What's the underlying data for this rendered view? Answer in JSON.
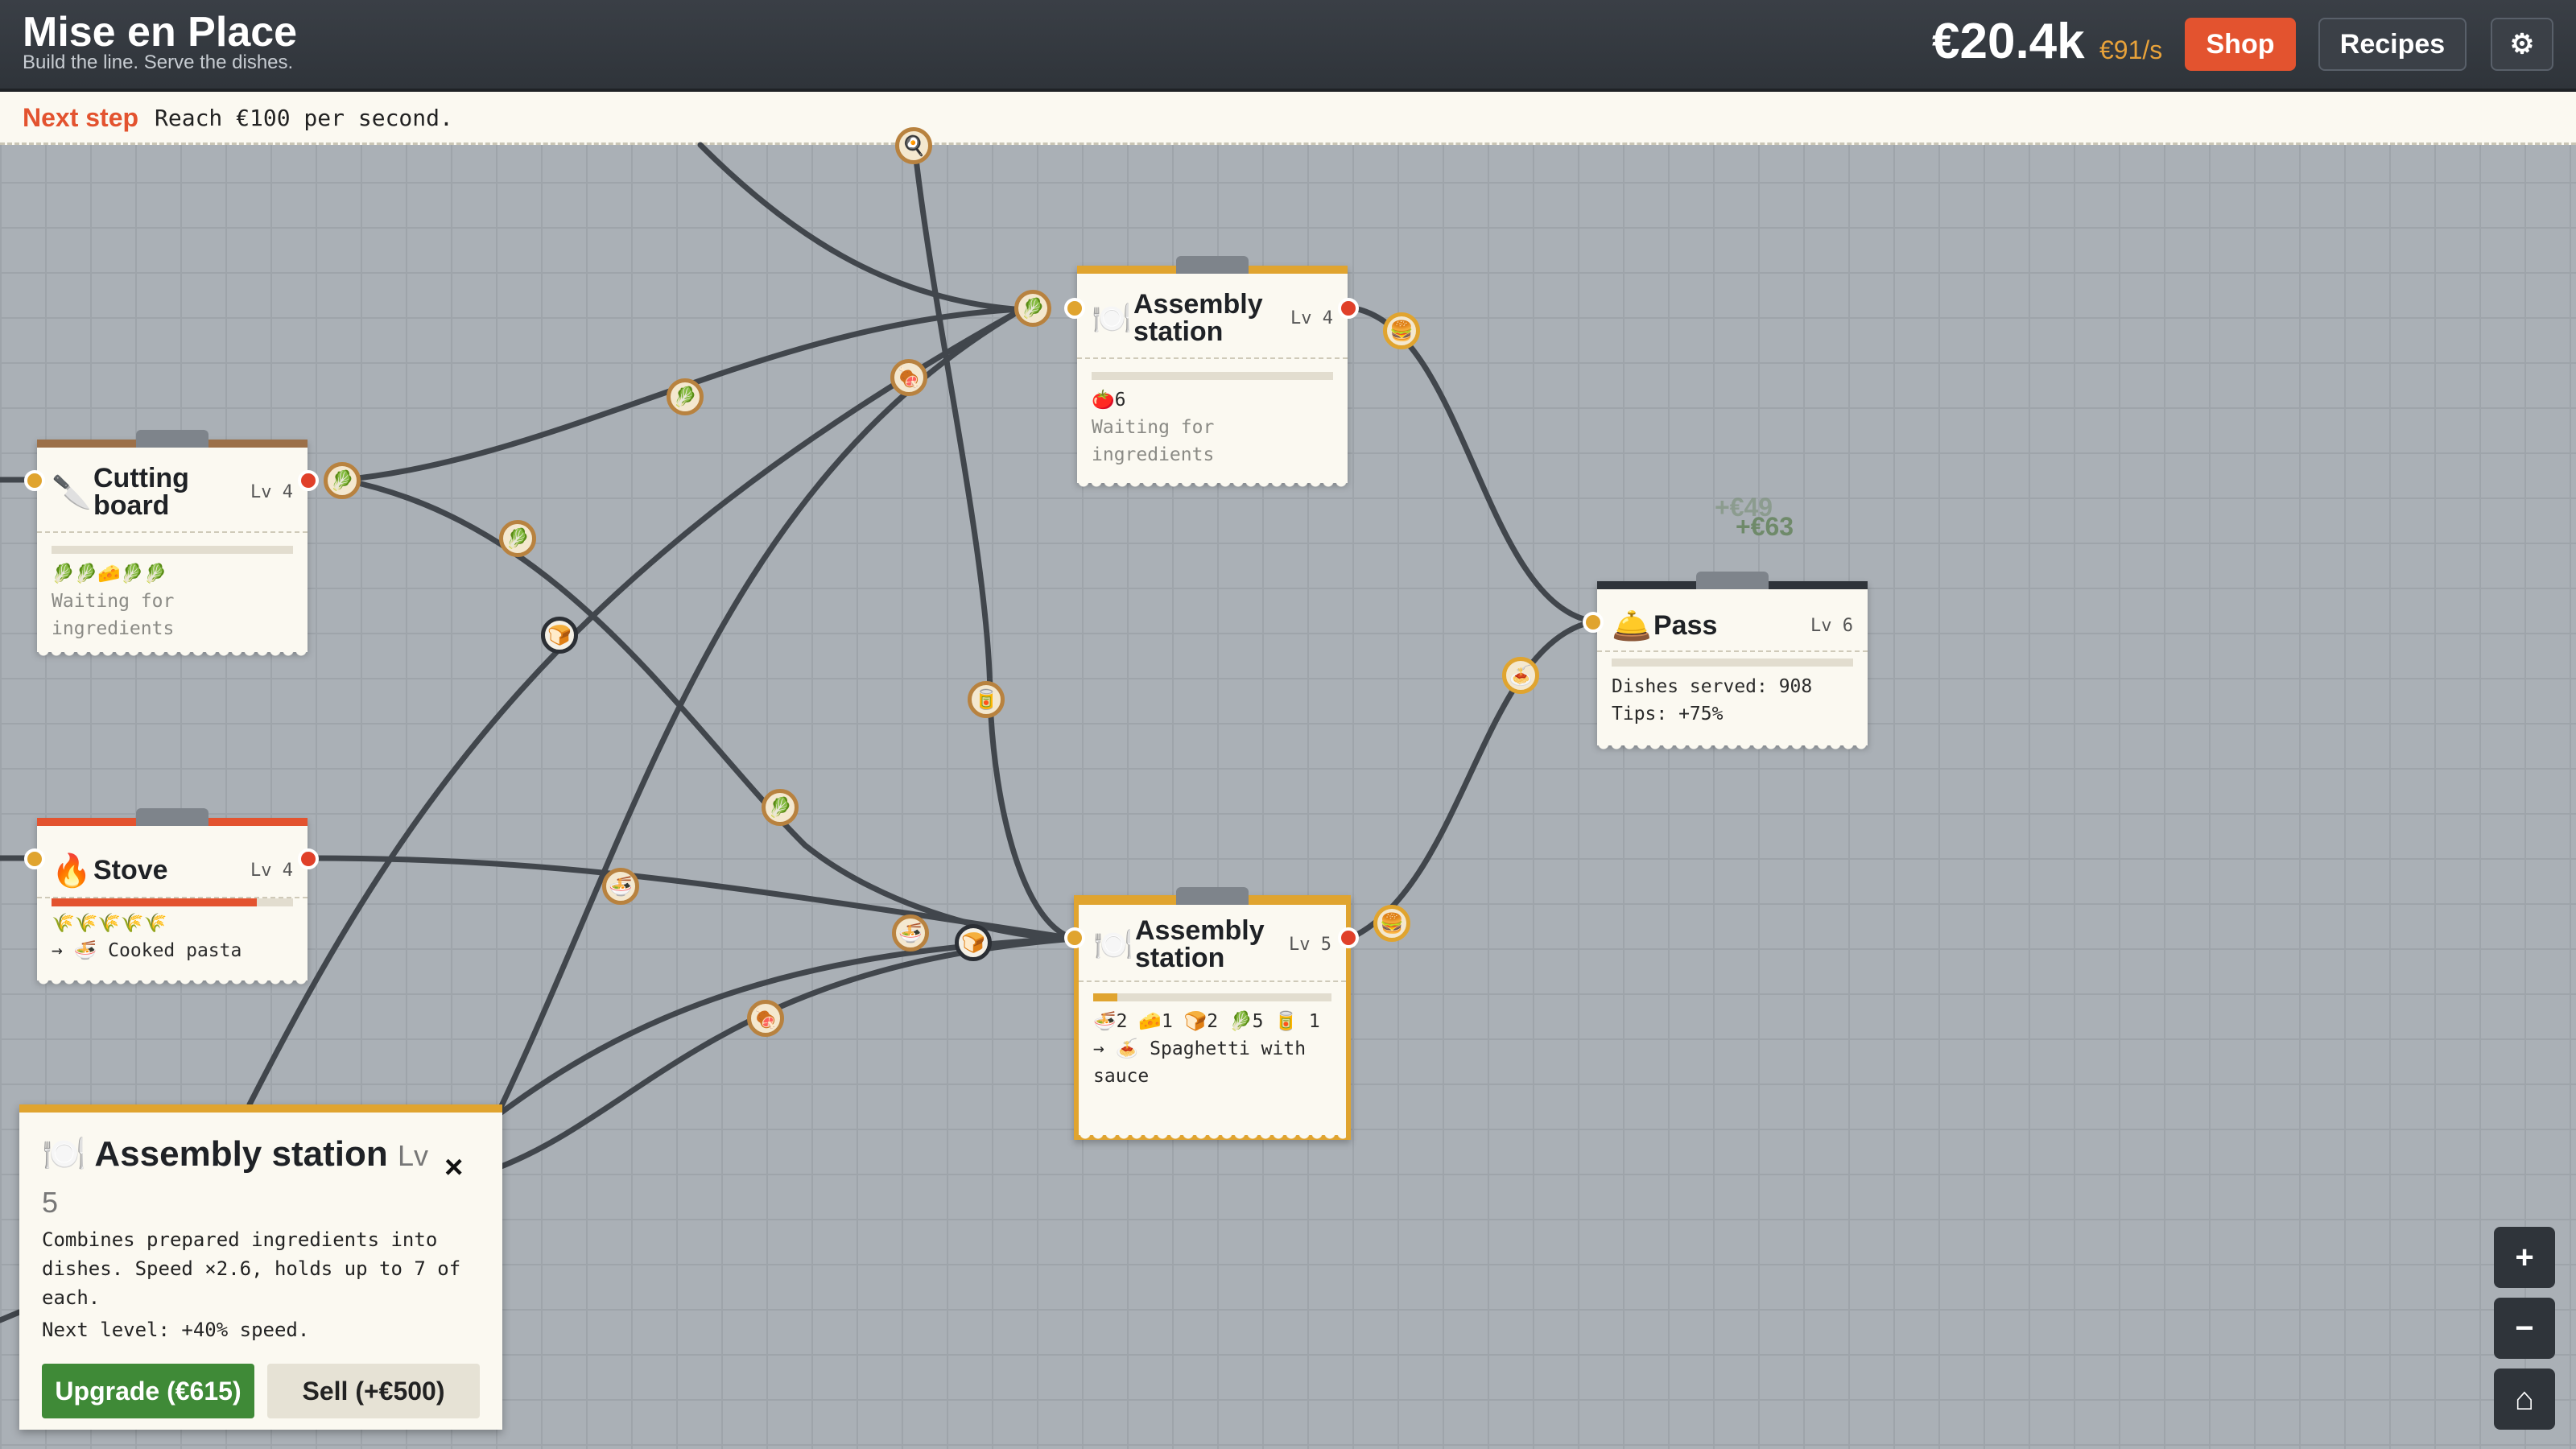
{
  "header": {
    "title": "Mise en Place",
    "subtitle": "Build the line. Serve the dishes.",
    "money": "€20.4k",
    "rate": "€91/s",
    "shop_label": "Shop",
    "recipes_label": "Recipes",
    "settings_icon": "gear-icon"
  },
  "hint": {
    "label": "Next step",
    "text": "Reach €100 per second."
  },
  "stations": {
    "cutting": {
      "icon": "🔪",
      "name": "Cutting board",
      "level": "Lv 4",
      "inventory": "🥬🥬🧀🥬🥬",
      "status": "Waiting for ingredients",
      "progress": 0
    },
    "stove": {
      "icon": "🔥",
      "name": "Stove",
      "level": "Lv 4",
      "inventory": "🌾🌾🌾🌾🌾",
      "status": "→ 🍜 Cooked pasta",
      "progress": 0.85
    },
    "assembly_top": {
      "icon": "🍽️",
      "name": "Assembly station",
      "level": "Lv 4",
      "inventory": "🍅6",
      "status": "Waiting for ingredients",
      "progress": 0
    },
    "assembly_bottom": {
      "icon": "🍽️",
      "name": "Assembly station",
      "level": "Lv 5",
      "inventory": "🍜2 🧀1 🍞2 🥬5 🥫 1",
      "status": "→ 🍝 Spaghetti with sauce",
      "progress": 0.1
    },
    "pass": {
      "icon": "🛎️",
      "name": "Pass",
      "level": "Lv 6",
      "served": "Dishes served: 908",
      "tips": "Tips: +75%",
      "progress": 0
    }
  },
  "floating_income": [
    "+€49",
    "+€63"
  ],
  "panel": {
    "icon": "🍽️",
    "title": "Assembly station",
    "level": "Lv 5",
    "close_icon": "×",
    "description": "Combines prepared ingredients into dishes. Speed ×2.6, holds up to 7 of each.",
    "next_level": "Next level: +40% speed.",
    "upgrade_label": "Upgrade (€615)",
    "sell_label": "Sell (+€500)"
  },
  "zoom": {
    "in_label": "+",
    "out_label": "−",
    "home_label": "⌂"
  },
  "colors": {
    "accent": "#e3532f",
    "gold": "#e0a42f",
    "upgrade": "#3f8a37",
    "header": "#2f343a"
  }
}
